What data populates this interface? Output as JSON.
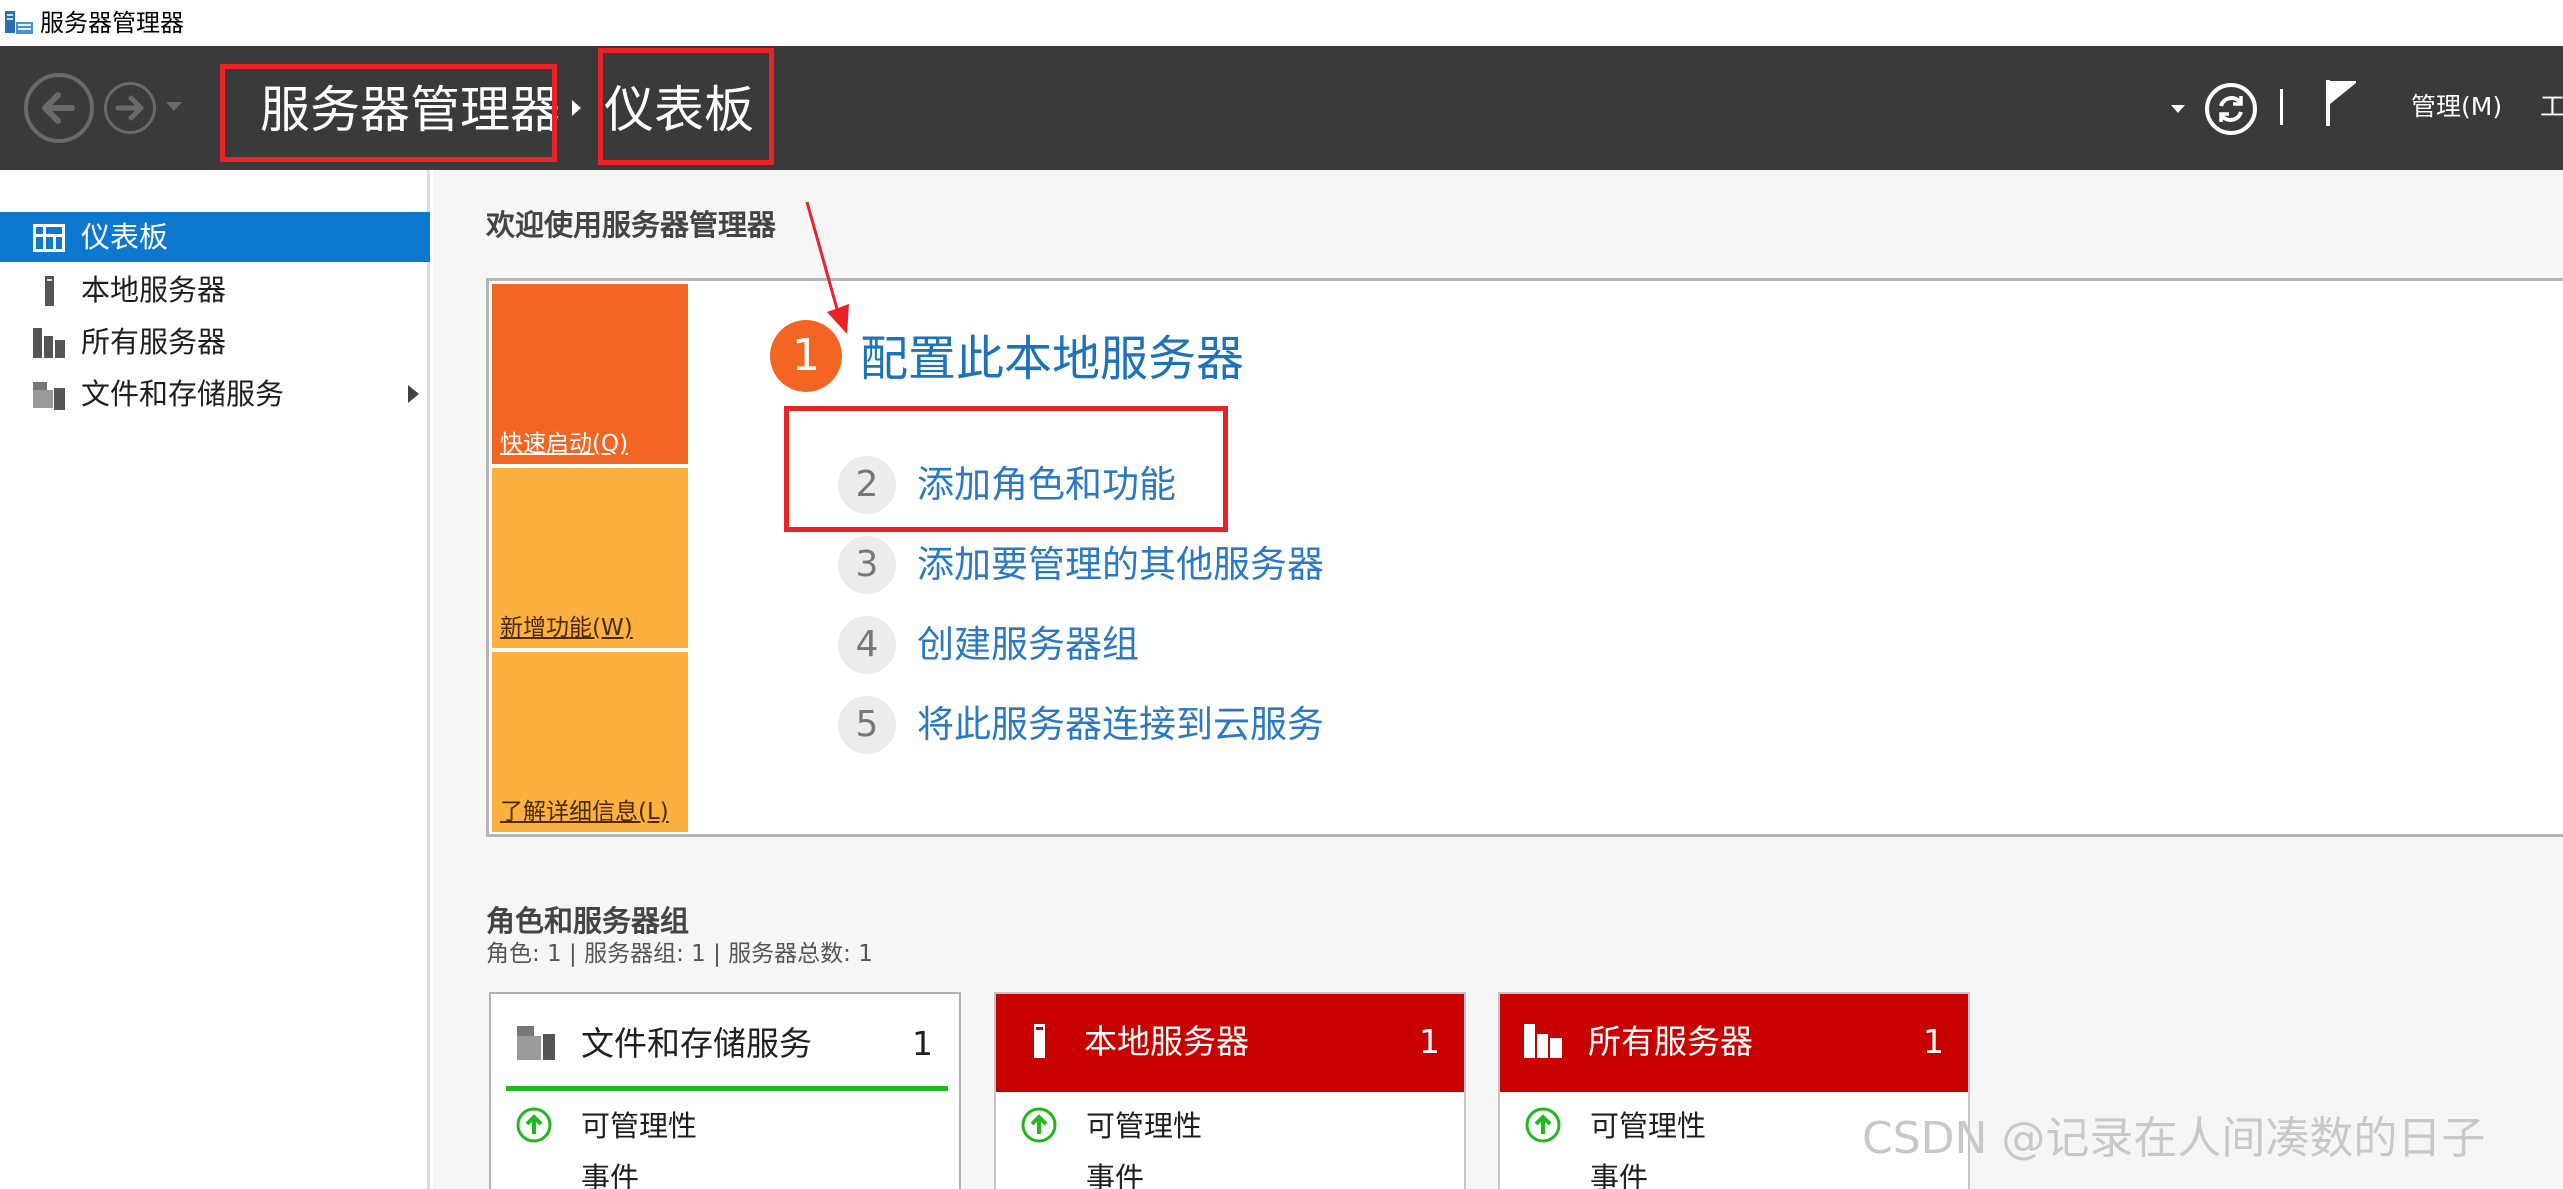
{
  "window": {
    "title": "服务器管理器"
  },
  "header": {
    "breadcrumb_root": "服务器管理器",
    "breadcrumb_current": "仪表板",
    "manage_menu": "管理(M)",
    "tools_menu": "工"
  },
  "sidebar": {
    "items": [
      {
        "label": "仪表板",
        "icon": "dashboard-icon",
        "selected": true
      },
      {
        "label": "本地服务器",
        "icon": "local-server-icon"
      },
      {
        "label": "所有服务器",
        "icon": "all-servers-icon"
      },
      {
        "label": "文件和存储服务",
        "icon": "file-storage-icon",
        "expandable": true
      }
    ]
  },
  "welcome": {
    "heading": "欢迎使用服务器管理器",
    "tiles": [
      {
        "label": "快速启动(Q)",
        "color": "#f26522"
      },
      {
        "label": "新增功能(W)",
        "color": "#fbb040"
      },
      {
        "label": "了解详细信息(L)",
        "color": "#fbb040"
      }
    ],
    "steps": [
      {
        "num": "1",
        "label": "配置此本地服务器"
      },
      {
        "num": "2",
        "label": "添加角色和功能"
      },
      {
        "num": "3",
        "label": "添加要管理的其他服务器"
      },
      {
        "num": "4",
        "label": "创建服务器组"
      },
      {
        "num": "5",
        "label": "将此服务器连接到云服务"
      }
    ]
  },
  "roles": {
    "heading": "角色和服务器组",
    "summary": "角色: 1 | 服务器组: 1 | 服务器总数: 1",
    "cards": [
      {
        "title": "文件和存储服务",
        "count": "1",
        "status": "ok",
        "row1": "可管理性",
        "row2": "事件"
      },
      {
        "title": "本地服务器",
        "count": "1",
        "status": "alert",
        "row1": "可管理性",
        "row2": "事件"
      },
      {
        "title": "所有服务器",
        "count": "1",
        "status": "alert",
        "row1": "可管理性",
        "row2": "事件"
      }
    ]
  },
  "colors": {
    "header_bg": "#3a3a3a",
    "selected_nav": "#0d78cd",
    "alert_red": "#c80000",
    "ok_green": "#1fb81f",
    "annotation_red": "#e8232a",
    "link_blue": "#2b79c2"
  },
  "watermark": "CSDN @记录在人间凑数的日子"
}
